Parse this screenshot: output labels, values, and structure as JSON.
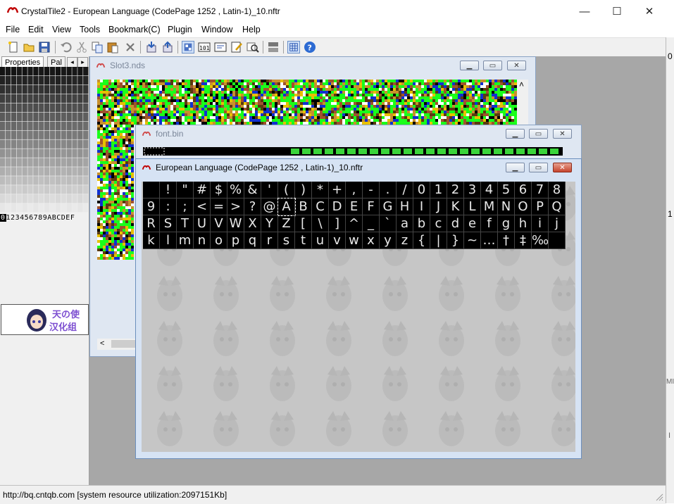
{
  "window": {
    "title": "CrystalTile2 - European Language (CodePage 1252 , Latin-1)_10.nftr",
    "controls": {
      "minimize": "—",
      "maximize": "☐",
      "close": "✕"
    }
  },
  "menu": [
    "File",
    "Edit",
    "View",
    "Tools",
    "Bookmark(C)",
    "Plugin",
    "Window",
    "Help"
  ],
  "toolbar": {
    "icons": [
      "new-icon",
      "open-icon",
      "save-icon",
      "undo-icon",
      "cut-icon",
      "copy-icon",
      "paste-icon",
      "delete-icon",
      "import-icon",
      "export-icon",
      "tile-viewer-icon",
      "hex-icon",
      "text-icon",
      "edit-icon",
      "search-icon",
      "compare-icon",
      "grid-icon",
      "help-icon"
    ]
  },
  "left_panel": {
    "tabs": [
      "Properties",
      "Pal"
    ],
    "tab_arrows": [
      "◂",
      "▸"
    ],
    "hex_digits": "0123456789ABCDEF",
    "logo_text": [
      "天の使",
      "汉化组"
    ]
  },
  "right_strip": {
    "labels": [
      "0",
      "1",
      "MI",
      "I"
    ]
  },
  "mdi": {
    "windows": [
      {
        "id": "slot3",
        "title": "Slot3.nds",
        "active": false
      },
      {
        "id": "fontbin",
        "title": "font.bin",
        "active": false
      },
      {
        "id": "nftr",
        "title": "European Language (CodePage 1252 , Latin-1)_10.nftr",
        "active": true
      }
    ],
    "glyph_rows": [
      [
        " ",
        "!",
        "\"",
        "#",
        "$",
        "%",
        "&",
        "'",
        "(",
        ")",
        "*",
        "+",
        ",",
        "-",
        ".",
        "/",
        "0",
        "1",
        "2",
        "3",
        "4",
        "5",
        "6",
        "7",
        "8"
      ],
      [
        "9",
        ":",
        ";",
        "<",
        "=",
        ">",
        "?",
        "@",
        "A",
        "B",
        "C",
        "D",
        "E",
        "F",
        "G",
        "H",
        "I",
        "J",
        "K",
        "L",
        "M",
        "N",
        "O",
        "P",
        "Q"
      ],
      [
        "R",
        "S",
        "T",
        "U",
        "V",
        "W",
        "X",
        "Y",
        "Z",
        "[",
        "\\",
        "]",
        "^",
        "_",
        "`",
        "a",
        "b",
        "c",
        "d",
        "e",
        "f",
        "g",
        "h",
        "i",
        "j"
      ],
      [
        "k",
        "l",
        "m",
        "n",
        "o",
        "p",
        "q",
        "r",
        "s",
        "t",
        "u",
        "v",
        "w",
        "x",
        "y",
        "z",
        "{",
        "|",
        "}",
        "~",
        "…",
        "†",
        "‡",
        "‰",
        ""
      ]
    ],
    "glyph_selected": "A",
    "scroll_arrows": {
      "up": "˄",
      "left": "<"
    }
  },
  "status": {
    "text": "http://bq.cntqb.com [system resource utilization:2097151Kb]"
  },
  "colors": {
    "mdi_bg": "#a7a7a7",
    "font_grid_bg": "#000000",
    "glyph_color": "#e8e8e8",
    "tile_green": "#1aff1a"
  }
}
